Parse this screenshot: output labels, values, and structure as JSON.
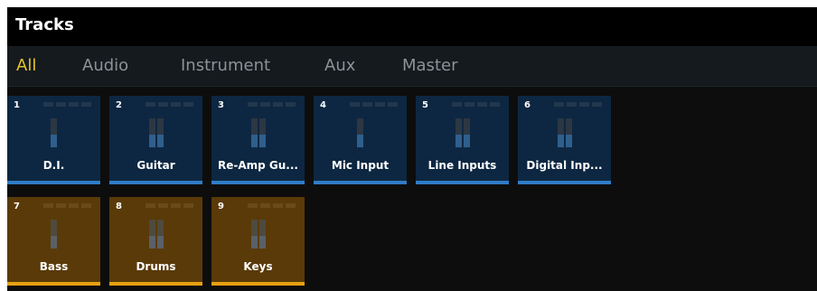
{
  "window": {
    "title": "Tracks"
  },
  "tabs": [
    {
      "label": "All",
      "active": true
    },
    {
      "label": "Audio",
      "active": false
    },
    {
      "label": "Instrument",
      "active": false
    },
    {
      "label": "Aux",
      "active": false
    },
    {
      "label": "Master",
      "active": false
    }
  ],
  "tracks": [
    {
      "number": "1",
      "name": "D.I.",
      "color": "blue",
      "meter_channels": 1
    },
    {
      "number": "2",
      "name": "Guitar",
      "color": "blue",
      "meter_channels": 2
    },
    {
      "number": "3",
      "name": "Re-Amp Gu...",
      "color": "blue",
      "meter_channels": 2
    },
    {
      "number": "4",
      "name": "Mic Input",
      "color": "blue",
      "meter_channels": 1
    },
    {
      "number": "5",
      "name": "Line Inputs",
      "color": "blue",
      "meter_channels": 2
    },
    {
      "number": "6",
      "name": "Digital Inp...",
      "color": "blue",
      "meter_channels": 2
    },
    {
      "number": "7",
      "name": "Bass",
      "color": "orange",
      "meter_channels": 1
    },
    {
      "number": "8",
      "name": "Drums",
      "color": "orange",
      "meter_channels": 2
    },
    {
      "number": "9",
      "name": "Keys",
      "color": "orange",
      "meter_channels": 2
    }
  ],
  "colors": {
    "active_tab": "#e6c229",
    "blue_track": "#0d2742",
    "blue_bar": "#2f7cc7",
    "orange_track": "#5a3a08",
    "orange_bar": "#e6a012"
  }
}
